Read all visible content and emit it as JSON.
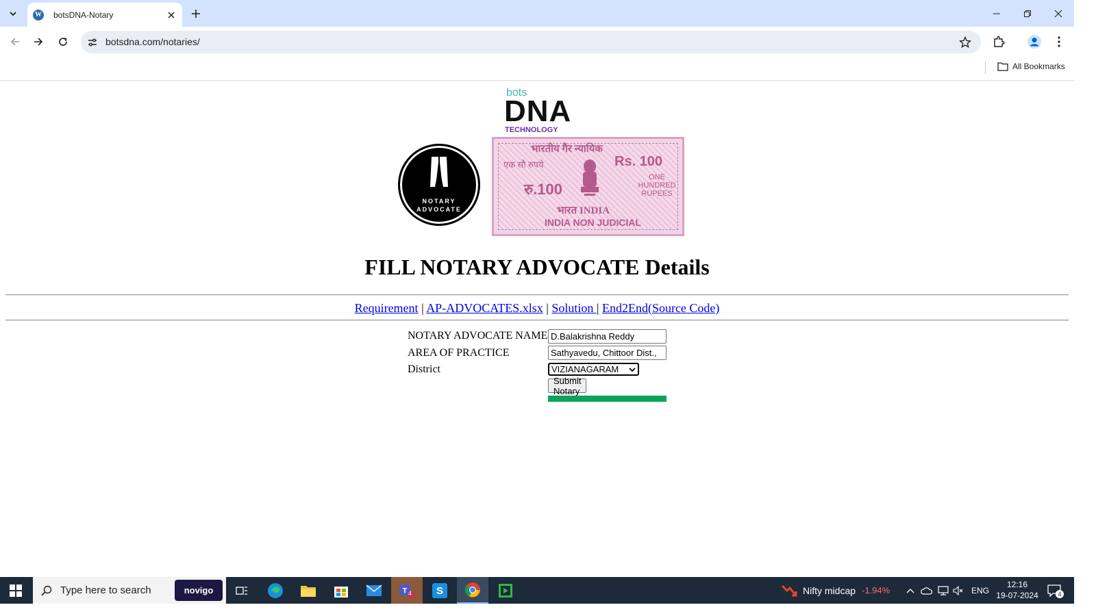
{
  "browser": {
    "tab_title": "botsDNA-Notary",
    "url": "botsdna.com/notaries/",
    "bookmarks_label": "All Bookmarks"
  },
  "page": {
    "logo": {
      "bots": "bots",
      "dna": "DNA",
      "tech": "TECHNOLOGY"
    },
    "badge": {
      "line1": "NOTARY",
      "line2": "ADVOCATE"
    },
    "stamp": {
      "hindi_top": "भारतीय गैर न्यायिक",
      "hindi_left": "एक सौ रुपये",
      "rs": "Rs. 100",
      "ru": "रु.100",
      "one_hundred": "ONE HUNDRED RUPEES",
      "india": "भारत INDIA",
      "non_judicial": "INDIA NON JUDICIAL"
    },
    "heading": "FILL NOTARY ADVOCATE Details",
    "links": {
      "requirement": "Requirement",
      "excel": "AP-ADVOCATES.xlsx",
      "solution": "Solution ",
      "end2end": "End2End(Source Code)",
      "sep": "|"
    },
    "form": {
      "name_label": "NOTARY ADVOCATE NAME",
      "name_value": "D.Balakrishna Reddy",
      "area_label": "AREA OF PRACTICE",
      "area_value": "Sathyavedu, Chittoor Dist.,",
      "district_label": "District",
      "district_value": "VIZIANAGARAM",
      "submit_label": "Submit Notary",
      "progress": 1.0
    }
  },
  "taskbar": {
    "search_placeholder": "Type here to search",
    "novigo": "novigo",
    "teams_badge": "4",
    "ticker_name": "Nifty midcap",
    "ticker_change": "-1.94%",
    "lang": "ENG",
    "time": "12:16",
    "date": "19-07-2024",
    "notifications": "4"
  },
  "colors": {
    "accent_green": "#0ba45a",
    "link_blue": "#0000ee",
    "ticker_red": "#ff6b6b"
  }
}
